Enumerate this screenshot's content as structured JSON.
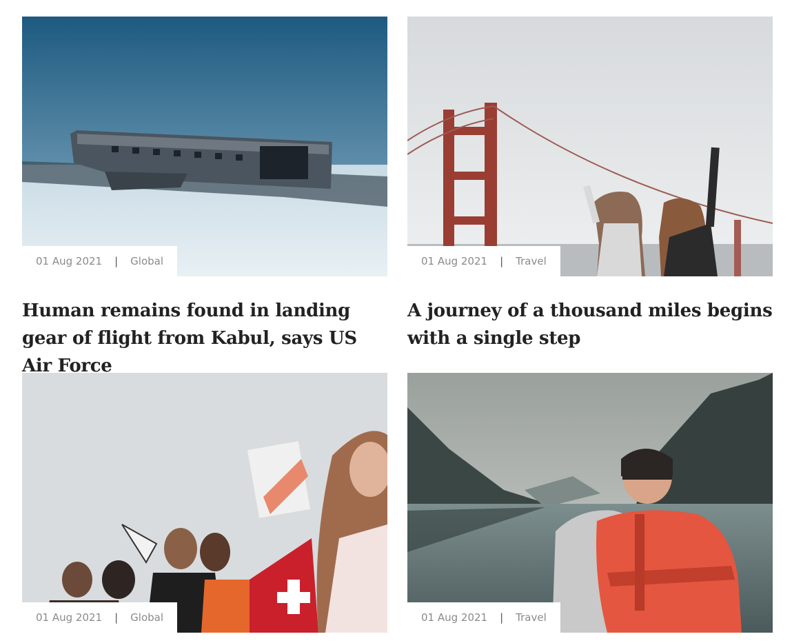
{
  "posts": [
    {
      "date": "01 Aug 2021",
      "separator": "|",
      "category": "Global",
      "title": "Human remains found in landing gear of flight from Kabul, says US Air Force",
      "image": "crashed-plane-on-black-sand-beach"
    },
    {
      "date": "01 Aug 2021",
      "separator": "|",
      "category": "Travel",
      "title": "A journey of a thousand miles begins with a single step",
      "image": "two-women-at-golden-gate-bridge"
    },
    {
      "date": "01 Aug 2021",
      "separator": "|",
      "category": "Global",
      "title": "",
      "image": "protest-crowd-with-megaphone"
    },
    {
      "date": "01 Aug 2021",
      "separator": "|",
      "category": "Travel",
      "title": "",
      "image": "hiker-with-orange-backpack-at-mountain-lake"
    }
  ]
}
